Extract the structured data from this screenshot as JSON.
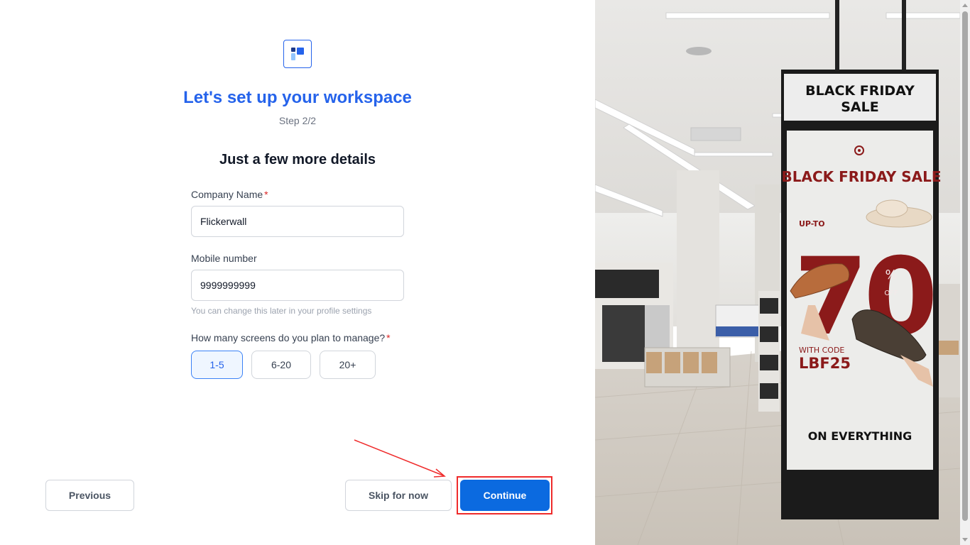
{
  "form": {
    "title": "Let's set up your workspace",
    "step": "Step 2/2",
    "subtitle": "Just a few more details",
    "company": {
      "label": "Company Name",
      "required_mark": "*",
      "value": "Flickerwall"
    },
    "mobile": {
      "label": "Mobile number",
      "value": "9999999999",
      "hint": "You can change this later in your profile settings"
    },
    "screens": {
      "label": "How many screens do you plan to manage?",
      "required_mark": "*",
      "options": [
        "1-5",
        "6-20",
        "20+"
      ],
      "selected": "1-5"
    }
  },
  "actions": {
    "previous": "Previous",
    "skip": "Skip for now",
    "continue": "Continue"
  },
  "promo": {
    "sign_header_line1": "BLACK FRIDAY",
    "sign_header_line2": "SALE",
    "banner_title": "BLACK FRIDAY SALE",
    "up_to": "UP-TO",
    "discount_number": "70",
    "percent": "%",
    "off": "OFF",
    "with_code": "WITH CODE",
    "code": "LBF25",
    "footer": "ON EVERYTHING"
  },
  "colors": {
    "accent": "#2563eb",
    "continue_bg": "#0b6ae0",
    "required": "#dc2626",
    "annotation_red": "#ef2b2b",
    "sale_red": "#8b1a1a"
  },
  "icons": {
    "logo": "layout-panels-icon"
  }
}
